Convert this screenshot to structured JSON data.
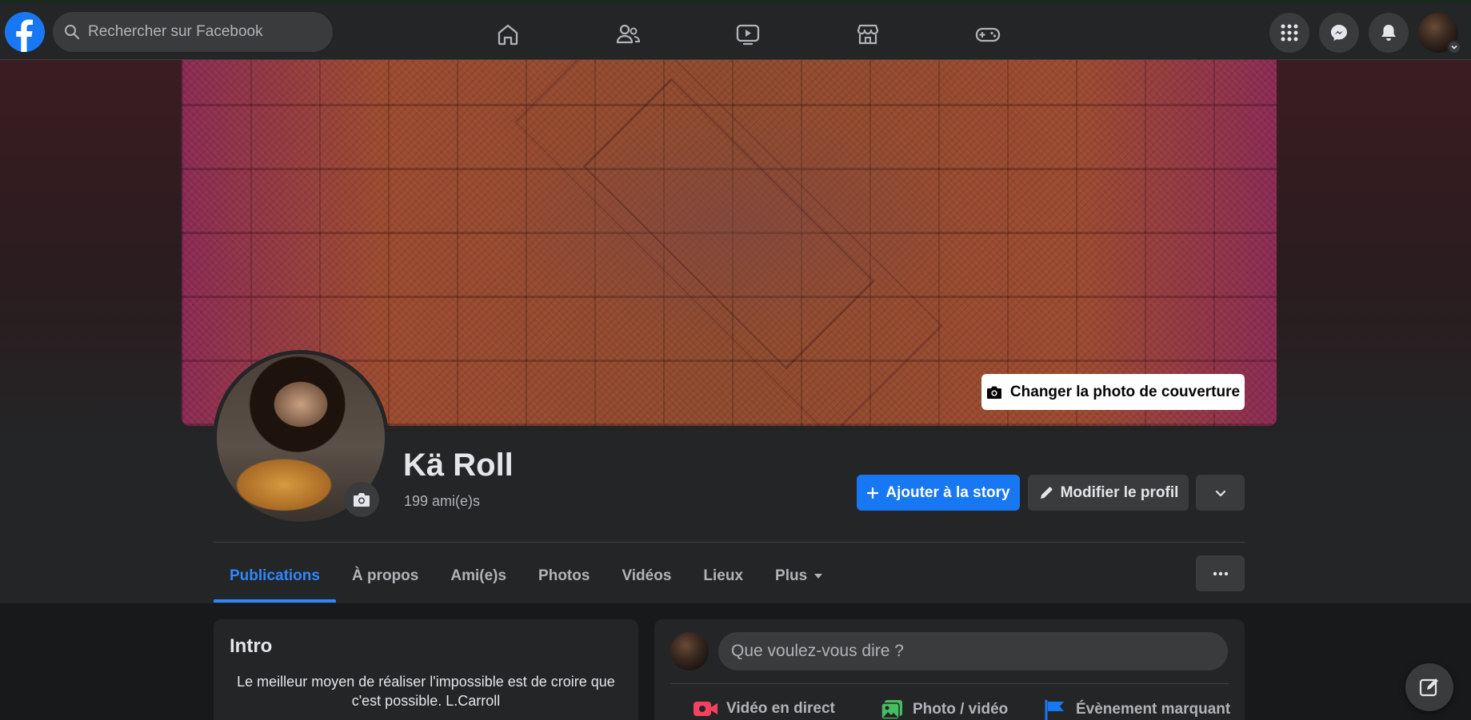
{
  "topbar": {
    "search_placeholder": "Rechercher sur Facebook",
    "nav_icons": [
      "home-icon",
      "friends-icon",
      "watch-icon",
      "marketplace-icon",
      "gaming-icon"
    ],
    "right_icons": [
      "menu-grid-icon",
      "messenger-icon",
      "bell-icon"
    ]
  },
  "cover": {
    "change_cover_label": "Changer la photo de couverture"
  },
  "profile": {
    "name": "Kä Roll",
    "friends_count": "199 ami(e)s"
  },
  "actions": {
    "add_story": "Ajouter à la story",
    "edit_profile": "Modifier le profil"
  },
  "tabs": [
    {
      "label": "Publications",
      "active": true
    },
    {
      "label": "À propos"
    },
    {
      "label": "Ami(e)s"
    },
    {
      "label": "Photos"
    },
    {
      "label": "Vidéos"
    },
    {
      "label": "Lieux"
    },
    {
      "label": "Plus"
    }
  ],
  "intro": {
    "title": "Intro",
    "bio": "Le meilleur moyen de réaliser l'impossible est de croire que c'est possible. L.Carroll"
  },
  "composer": {
    "placeholder": "Que voulez-vous dire ?",
    "actions": [
      {
        "label": "Vidéo en direct",
        "color": "#f3425f"
      },
      {
        "label": "Photo / vidéo",
        "color": "#45bd62"
      },
      {
        "label": "Évènement marquant",
        "color": "#1877f2"
      }
    ]
  },
  "colors": {
    "accent": "#1877f2",
    "active_tab": "#2d88ff",
    "surface": "#242526",
    "background": "#18191a"
  }
}
